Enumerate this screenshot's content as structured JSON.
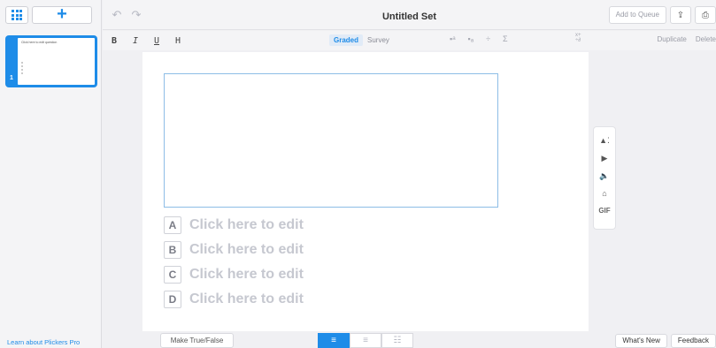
{
  "sidebar": {
    "add_label": "+",
    "slide": {
      "number": "1",
      "preview_text": "Click here to edit question"
    },
    "learn_link": "Learn about Plickers Pro"
  },
  "topbar": {
    "title": "Untitled Set",
    "undo_icon": "undo-icon",
    "redo_icon": "redo-icon",
    "add_to_queue": "Add to Queue"
  },
  "format": {
    "bold": "B",
    "italic": "I",
    "underline": "U",
    "heading": "H",
    "modes": [
      "Graded",
      "Survey"
    ],
    "active_mode": "Graded",
    "sigma": "Σ",
    "duplicate": "Duplicate",
    "delete": "Delete"
  },
  "answers": [
    {
      "letter": "A",
      "text": "Click here to edit"
    },
    {
      "letter": "B",
      "text": "Click here to edit"
    },
    {
      "letter": "C",
      "text": "Click here to edit"
    },
    {
      "letter": "D",
      "text": "Click here to edit"
    }
  ],
  "media": {
    "gif_label": "GIF"
  },
  "bottom": {
    "make_true_false": "Make True/False",
    "whats_new": "What's New",
    "feedback": "Feedback"
  },
  "colors": {
    "accent": "#1e8ce8",
    "question_border": "#8dbde6",
    "placeholder_text": "#c6c8d0"
  }
}
